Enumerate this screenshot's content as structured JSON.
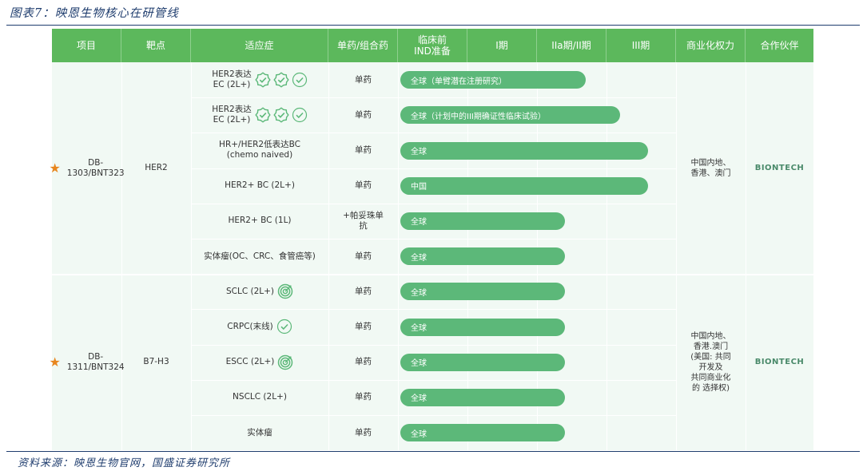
{
  "figure_title": "图表7：映恩生物核心在研管线",
  "source": "资料来源：映恩生物官网，国盛证券研究所",
  "colors": {
    "header": "#5cb85c",
    "bar": "#5cb879",
    "star": "#e8861e",
    "rule": "#1f3d6e"
  },
  "headers": [
    "项目",
    "靶点",
    "适应症",
    "单药/组合药",
    "临床前\nIND准备",
    "I期",
    "IIa期/II期",
    "III期",
    "商业化权力",
    "合作伙伴"
  ],
  "groups": [
    {
      "drug": "DB-\n1303/BNT323",
      "target": "HER2",
      "rights": "中国内地、\n香港、澳门",
      "partner": "BIONTECH",
      "rows": [
        {
          "indication": "HER2表达\nEC (2L+)",
          "icons": [
            "badge-check-icon",
            "badge-check-icon",
            "circle-check-icon"
          ],
          "mode": "单药",
          "bar_text": "全球（单臂潜在注册研究）",
          "bar_end_phase": 2.7
        },
        {
          "indication": "HER2表达\nEC (2L+)",
          "icons": [
            "badge-check-icon",
            "badge-check-icon",
            "circle-check-icon"
          ],
          "mode": "单药",
          "bar_text": "全球（计划中的III期确证性临床试验）",
          "bar_end_phase": 3.2
        },
        {
          "indication": "HR+/HER2低表达BC\n(chemo naived)",
          "icons": [],
          "mode": "单药",
          "bar_text": "全球",
          "bar_end_phase": 3.6
        },
        {
          "indication": "HER2+ BC (2L+)",
          "icons": [],
          "mode": "单药",
          "bar_text": "中国",
          "bar_end_phase": 3.6
        },
        {
          "indication": "HER2+ BC (1L)",
          "icons": [],
          "mode": "+帕妥珠单\n抗",
          "bar_text": "全球",
          "bar_end_phase": 2.4
        },
        {
          "indication": "实体瘤(OC、CRC、食管癌等)",
          "icons": [],
          "mode": "单药",
          "bar_text": "全球",
          "bar_end_phase": 2.4
        }
      ]
    },
    {
      "drug": "DB-\n1311/BNT324",
      "target": "B7-H3",
      "rights": "中国内地、\n香港.澳门\n(美国: 共同\n开发及\n共同商业化\n的 选择权)",
      "partner": "BIONTECH",
      "rows": [
        {
          "indication": "SCLC (2L+)",
          "icons": [
            "target-icon"
          ],
          "mode": "单药",
          "bar_text": "全球",
          "bar_end_phase": 2.4
        },
        {
          "indication": "CRPC(末线)",
          "icons": [
            "circle-check-icon"
          ],
          "mode": "单药",
          "bar_text": "全球",
          "bar_end_phase": 2.4
        },
        {
          "indication": "ESCC (2L+)",
          "icons": [
            "target-icon"
          ],
          "mode": "单药",
          "bar_text": "全球",
          "bar_end_phase": 2.4
        },
        {
          "indication": "NSCLC (2L+)",
          "icons": [],
          "mode": "单药",
          "bar_text": "全球",
          "bar_end_phase": 2.4
        },
        {
          "indication": "实体瘤",
          "icons": [],
          "mode": "单药",
          "bar_text": "全球",
          "bar_end_phase": 2.4
        }
      ]
    }
  ]
}
